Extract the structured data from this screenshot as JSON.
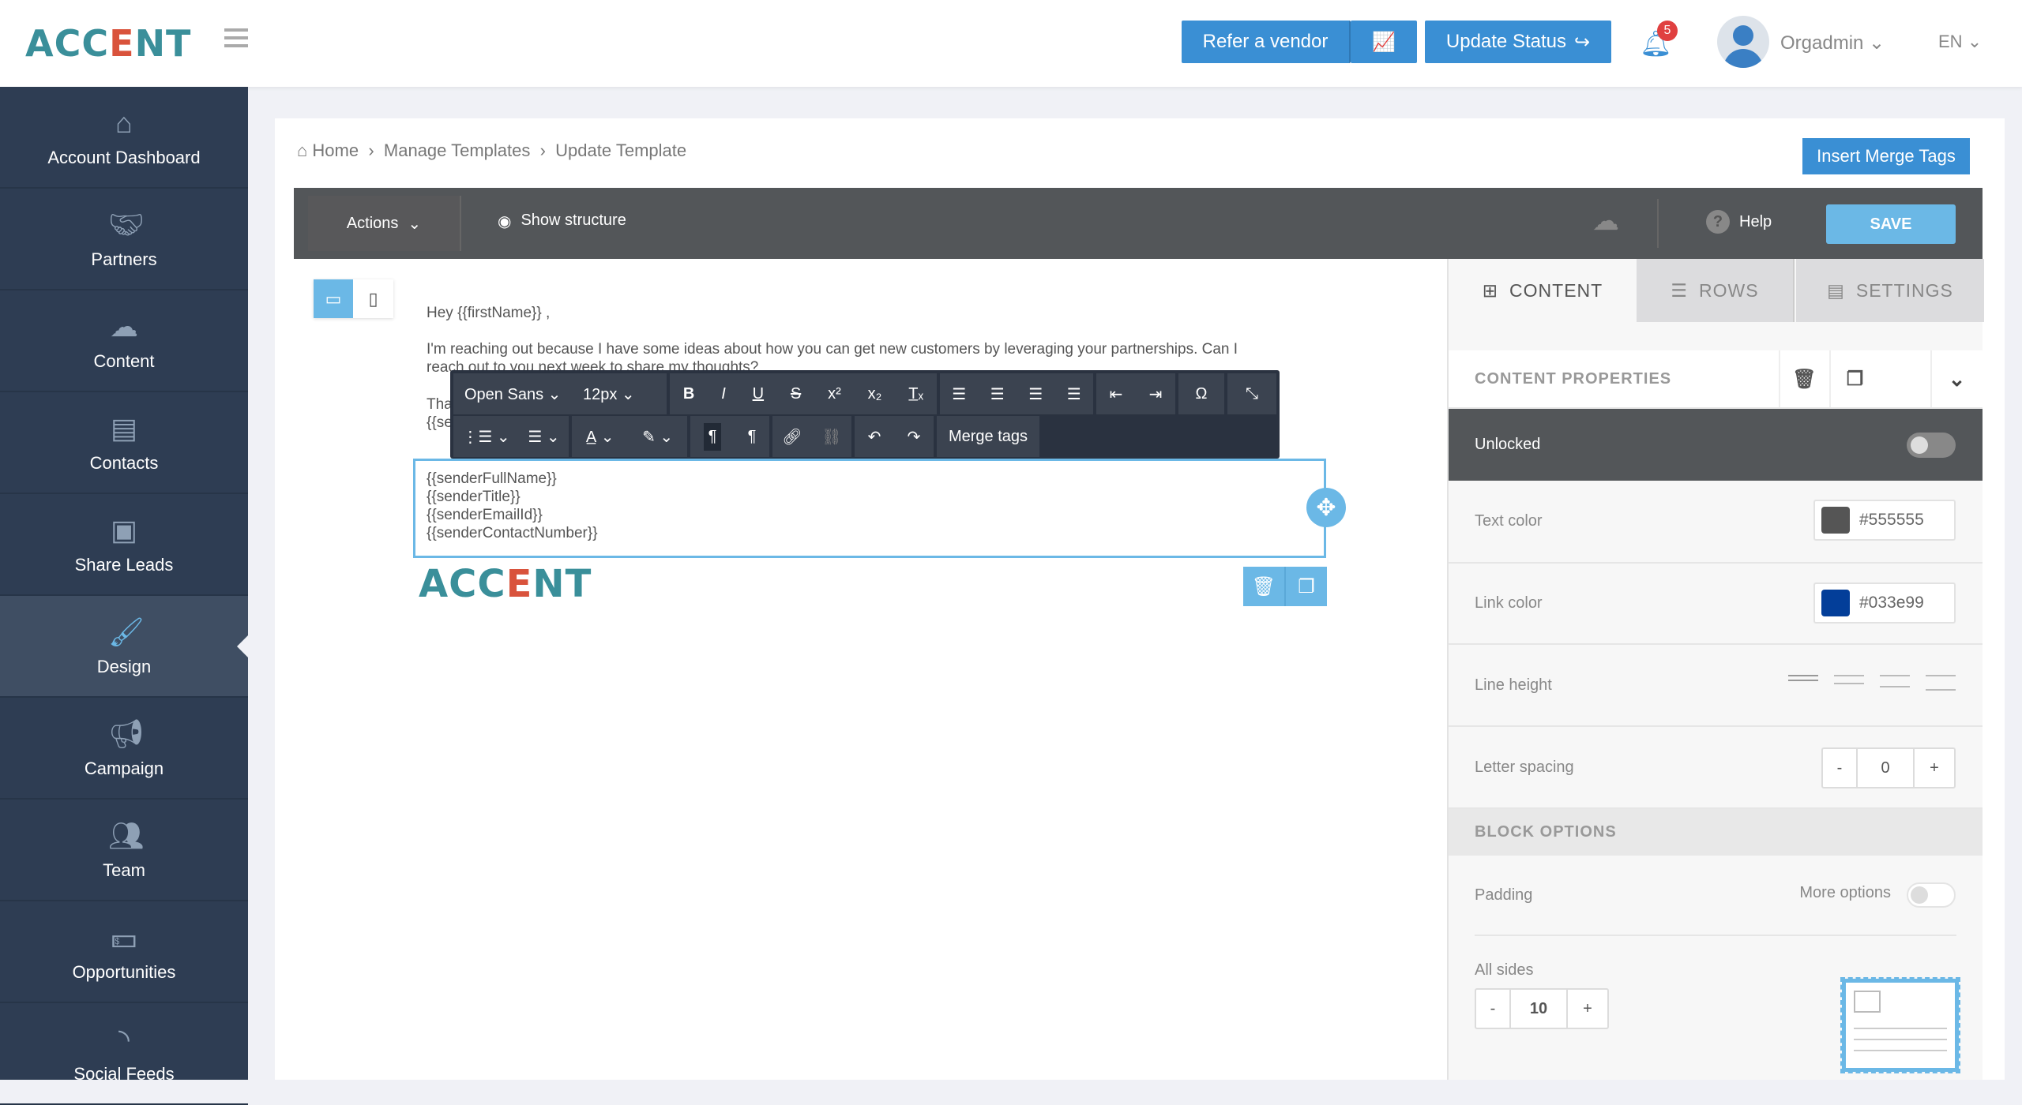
{
  "header": {
    "logo": "ACCENT",
    "refer_vendor": "Refer a vendor",
    "update_status": "Update Status",
    "notifications": "5",
    "user": "Orgadmin",
    "language": "EN"
  },
  "sidebar": {
    "items": [
      {
        "label": "Account Dashboard",
        "icon": "home-icon"
      },
      {
        "label": "Partners",
        "icon": "handshake-icon"
      },
      {
        "label": "Content",
        "icon": "cloud-upload-icon"
      },
      {
        "label": "Contacts",
        "icon": "contact-card-icon"
      },
      {
        "label": "Share Leads",
        "icon": "badge-icon"
      },
      {
        "label": "Design",
        "icon": "brush-icon",
        "active": true
      },
      {
        "label": "Campaign",
        "icon": "megaphone-icon"
      },
      {
        "label": "Team",
        "icon": "team-icon"
      },
      {
        "label": "Opportunities",
        "icon": "money-icon"
      },
      {
        "label": "Social Feeds",
        "icon": "rss-icon"
      }
    ]
  },
  "breadcrumb": [
    "Home",
    "Manage Templates",
    "Update Template"
  ],
  "insert_merge_tags": "Insert Merge Tags",
  "toolbar": {
    "actions": "Actions",
    "show_structure": "Show structure",
    "help": "Help",
    "save": "SAVE"
  },
  "email": {
    "greeting": "Hey {{firstName}} ,",
    "paragraph1": "I'm reaching out because I have some ideas about how you can get new customers by leveraging your partnerships. Can I",
    "paragraph1b": "reach out to you next week to share my thoughts?",
    "partial1": "Tha",
    "partial2": "{{se",
    "signature": [
      "{{senderFullName}}",
      "{{senderTitle}}",
      "{{senderEmailId}}",
      "{{senderContactNumber}}"
    ],
    "logo": "ACCENT"
  },
  "format_toolbar": {
    "font": "Open Sans",
    "size": "12px",
    "merge_tags": "Merge tags"
  },
  "panel": {
    "tabs": [
      "CONTENT",
      "ROWS",
      "SETTINGS"
    ],
    "content_properties": "CONTENT PROPERTIES",
    "unlocked": "Unlocked",
    "text_color_label": "Text color",
    "text_color": "#555555",
    "link_color_label": "Link color",
    "link_color": "#033e99",
    "line_height": "Line height",
    "letter_spacing": "Letter spacing",
    "letter_spacing_value": "0",
    "block_options": "BLOCK OPTIONS",
    "padding": "Padding",
    "more_options": "More options",
    "all_sides": "All sides",
    "all_sides_value": "10",
    "minus": "-",
    "plus": "+"
  },
  "colors": {
    "accent": "#3a8fd4",
    "sidebar": "#2e3d53",
    "toolbar": "#535659",
    "save": "#6bb8e6"
  }
}
